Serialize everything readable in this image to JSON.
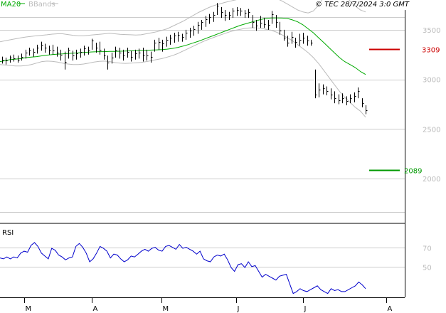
{
  "header": {
    "legend_ma": "MA20",
    "legend_bb": "BBands",
    "copyright": "© TEC 28/7/2024 3:0 GMT"
  },
  "colors": {
    "ma": "#00aa00",
    "bbands": "#bbbbbb",
    "price": "#000000",
    "rsi": "#0000cc",
    "resistance": "#cc0000",
    "support": "#009900",
    "grid": "#cccccc"
  },
  "chart_data": [
    {
      "type": "ohlc",
      "panel": "price",
      "y_ticks": [
        "3500",
        "3000",
        "2500",
        "2000"
      ],
      "ylim": [
        1550,
        3700
      ],
      "grid": true,
      "x_month_labels": [
        "M",
        "A",
        "M",
        "J",
        "J",
        "A"
      ],
      "resistance": {
        "value": 3309,
        "label": "3309"
      },
      "support": {
        "value": 2089,
        "label": "2089"
      },
      "bars": [
        {
          "h": 3230,
          "l": 3160,
          "c": 3200
        },
        {
          "h": 3220,
          "l": 3150,
          "c": 3190
        },
        {
          "h": 3240,
          "l": 3170,
          "c": 3220
        },
        {
          "h": 3250,
          "l": 3180,
          "c": 3210
        },
        {
          "h": 3240,
          "l": 3170,
          "c": 3200
        },
        {
          "h": 3260,
          "l": 3190,
          "c": 3230
        },
        {
          "h": 3300,
          "l": 3210,
          "c": 3270
        },
        {
          "h": 3320,
          "l": 3240,
          "c": 3290
        },
        {
          "h": 3310,
          "l": 3230,
          "c": 3280
        },
        {
          "h": 3350,
          "l": 3260,
          "c": 3320
        },
        {
          "h": 3380,
          "l": 3290,
          "c": 3350
        },
        {
          "h": 3360,
          "l": 3270,
          "c": 3320
        },
        {
          "h": 3340,
          "l": 3250,
          "c": 3300
        },
        {
          "h": 3350,
          "l": 3250,
          "c": 3290
        },
        {
          "h": 3330,
          "l": 3230,
          "c": 3270
        },
        {
          "h": 3300,
          "l": 3190,
          "c": 3250
        },
        {
          "h": 3280,
          "l": 3100,
          "c": 3180
        },
        {
          "h": 3320,
          "l": 3210,
          "c": 3290
        },
        {
          "h": 3290,
          "l": 3190,
          "c": 3240
        },
        {
          "h": 3300,
          "l": 3200,
          "c": 3260
        },
        {
          "h": 3310,
          "l": 3220,
          "c": 3280
        },
        {
          "h": 3340,
          "l": 3240,
          "c": 3310
        },
        {
          "h": 3330,
          "l": 3250,
          "c": 3300
        },
        {
          "h": 3410,
          "l": 3300,
          "c": 3390
        },
        {
          "h": 3370,
          "l": 3270,
          "c": 3320
        },
        {
          "h": 3380,
          "l": 3250,
          "c": 3300
        },
        {
          "h": 3310,
          "l": 3200,
          "c": 3240
        },
        {
          "h": 3240,
          "l": 3100,
          "c": 3170
        },
        {
          "h": 3270,
          "l": 3160,
          "c": 3220
        },
        {
          "h": 3330,
          "l": 3220,
          "c": 3300
        },
        {
          "h": 3320,
          "l": 3210,
          "c": 3270
        },
        {
          "h": 3300,
          "l": 3190,
          "c": 3240
        },
        {
          "h": 3320,
          "l": 3220,
          "c": 3280
        },
        {
          "h": 3290,
          "l": 3180,
          "c": 3230
        },
        {
          "h": 3300,
          "l": 3200,
          "c": 3260
        },
        {
          "h": 3310,
          "l": 3210,
          "c": 3270
        },
        {
          "h": 3320,
          "l": 3180,
          "c": 3250
        },
        {
          "h": 3300,
          "l": 3190,
          "c": 3240
        },
        {
          "h": 3280,
          "l": 3170,
          "c": 3230
        },
        {
          "h": 3400,
          "l": 3280,
          "c": 3370
        },
        {
          "h": 3420,
          "l": 3300,
          "c": 3380
        },
        {
          "h": 3400,
          "l": 3280,
          "c": 3360
        },
        {
          "h": 3430,
          "l": 3330,
          "c": 3400
        },
        {
          "h": 3450,
          "l": 3350,
          "c": 3420
        },
        {
          "h": 3470,
          "l": 3370,
          "c": 3440
        },
        {
          "h": 3480,
          "l": 3380,
          "c": 3450
        },
        {
          "h": 3460,
          "l": 3380,
          "c": 3430
        },
        {
          "h": 3500,
          "l": 3400,
          "c": 3470
        },
        {
          "h": 3520,
          "l": 3420,
          "c": 3490
        },
        {
          "h": 3540,
          "l": 3440,
          "c": 3510
        },
        {
          "h": 3580,
          "l": 3460,
          "c": 3550
        },
        {
          "h": 3600,
          "l": 3500,
          "c": 3580
        },
        {
          "h": 3640,
          "l": 3530,
          "c": 3610
        },
        {
          "h": 3660,
          "l": 3560,
          "c": 3630
        },
        {
          "h": 3680,
          "l": 3580,
          "c": 3650
        },
        {
          "h": 3770,
          "l": 3650,
          "c": 3740
        },
        {
          "h": 3730,
          "l": 3620,
          "c": 3680
        },
        {
          "h": 3700,
          "l": 3590,
          "c": 3650
        },
        {
          "h": 3680,
          "l": 3600,
          "c": 3650
        },
        {
          "h": 3720,
          "l": 3620,
          "c": 3690
        },
        {
          "h": 3730,
          "l": 3640,
          "c": 3700
        },
        {
          "h": 3720,
          "l": 3640,
          "c": 3690
        },
        {
          "h": 3700,
          "l": 3620,
          "c": 3670
        },
        {
          "h": 3710,
          "l": 3620,
          "c": 3680
        },
        {
          "h": 3650,
          "l": 3520,
          "c": 3580
        },
        {
          "h": 3600,
          "l": 3490,
          "c": 3540
        },
        {
          "h": 3640,
          "l": 3520,
          "c": 3570
        },
        {
          "h": 3620,
          "l": 3520,
          "c": 3560
        },
        {
          "h": 3600,
          "l": 3500,
          "c": 3550
        },
        {
          "h": 3690,
          "l": 3560,
          "c": 3660
        },
        {
          "h": 3650,
          "l": 3520,
          "c": 3580
        },
        {
          "h": 3580,
          "l": 3450,
          "c": 3490
        },
        {
          "h": 3500,
          "l": 3390,
          "c": 3420
        },
        {
          "h": 3440,
          "l": 3330,
          "c": 3370
        },
        {
          "h": 3480,
          "l": 3360,
          "c": 3430
        },
        {
          "h": 3420,
          "l": 3320,
          "c": 3380
        },
        {
          "h": 3460,
          "l": 3340,
          "c": 3400
        },
        {
          "h": 3470,
          "l": 3360,
          "c": 3420
        },
        {
          "h": 3440,
          "l": 3340,
          "c": 3390
        },
        {
          "h": 3400,
          "l": 3340,
          "c": 3370
        },
        {
          "h": 3100,
          "l": 2810,
          "c": 2850
        },
        {
          "h": 2960,
          "l": 2820,
          "c": 2900
        },
        {
          "h": 2950,
          "l": 2850,
          "c": 2910
        },
        {
          "h": 2930,
          "l": 2840,
          "c": 2880
        },
        {
          "h": 2910,
          "l": 2800,
          "c": 2850
        },
        {
          "h": 2880,
          "l": 2760,
          "c": 2810
        },
        {
          "h": 2850,
          "l": 2750,
          "c": 2790
        },
        {
          "h": 2860,
          "l": 2760,
          "c": 2810
        },
        {
          "h": 2830,
          "l": 2740,
          "c": 2780
        },
        {
          "h": 2850,
          "l": 2760,
          "c": 2810
        },
        {
          "h": 2870,
          "l": 2770,
          "c": 2830
        },
        {
          "h": 2920,
          "l": 2810,
          "c": 2880
        },
        {
          "h": 2810,
          "l": 2720,
          "c": 2760
        },
        {
          "h": 2740,
          "l": 2650,
          "c": 2690
        }
      ],
      "ma20": [
        3180,
        3190,
        3200,
        3205,
        3210,
        3220,
        3225,
        3230,
        3238,
        3245,
        3250,
        3255,
        3258,
        3262,
        3265,
        3268,
        3272,
        3275,
        3278,
        3280,
        3280,
        3282,
        3283,
        3284,
        3286,
        3288,
        3290,
        3292,
        3294,
        3296,
        3298,
        3300,
        3305,
        3312,
        3322,
        3335,
        3350,
        3368,
        3385,
        3405,
        3425,
        3445,
        3465,
        3485,
        3505,
        3525,
        3545,
        3560,
        3575,
        3590,
        3605,
        3615,
        3620,
        3620,
        3618,
        3615,
        3600,
        3580,
        3550,
        3510,
        3470,
        3420,
        3370,
        3320,
        3270,
        3220,
        3180,
        3150,
        3120,
        3080,
        3050
      ],
      "bb_upper": [
        3380,
        3390,
        3400,
        3410,
        3420,
        3428,
        3434,
        3440,
        3445,
        3450,
        3456,
        3460,
        3460,
        3452,
        3445,
        3440,
        3440,
        3445,
        3450,
        3455,
        3460,
        3465,
        3460,
        3455,
        3452,
        3450,
        3448,
        3450,
        3460,
        3470,
        3480,
        3495,
        3510,
        3535,
        3560,
        3585,
        3615,
        3645,
        3675,
        3700,
        3725,
        3745,
        3760,
        3775,
        3788,
        3800,
        3812,
        3822,
        3830,
        3835,
        3835,
        3835,
        3828,
        3815,
        3790,
        3760,
        3730,
        3700,
        3680,
        3670,
        3690,
        3750,
        3830,
        3910,
        3930,
        3900,
        3850,
        3790,
        3740,
        3700,
        3680
      ],
      "bb_lower": [
        3150,
        3145,
        3140,
        3135,
        3135,
        3140,
        3150,
        3165,
        3180,
        3185,
        3182,
        3175,
        3165,
        3155,
        3150,
        3150,
        3155,
        3165,
        3175,
        3182,
        3185,
        3180,
        3170,
        3165,
        3162,
        3165,
        3168,
        3172,
        3180,
        3190,
        3200,
        3210,
        3225,
        3240,
        3260,
        3285,
        3310,
        3335,
        3360,
        3385,
        3405,
        3425,
        3445,
        3462,
        3480,
        3495,
        3505,
        3515,
        3520,
        3520,
        3515,
        3505,
        3495,
        3475,
        3450,
        3420,
        3390,
        3350,
        3310,
        3270,
        3220,
        3160,
        3090,
        3020,
        2950,
        2880,
        2820,
        2770,
        2720,
        2680,
        2620
      ],
      "overlay_x_range": [
        0,
        514
      ]
    },
    {
      "type": "line",
      "panel": "rsi",
      "title": "RSI",
      "y_ticks": [
        "70",
        "50"
      ],
      "ylim": [
        18,
        92
      ],
      "values": [
        59,
        58,
        60,
        58,
        60,
        59,
        64,
        66,
        65,
        72,
        75,
        71,
        64,
        61,
        58,
        69,
        67,
        62,
        60,
        57,
        59,
        60,
        71,
        74,
        70,
        64,
        55,
        58,
        64,
        71,
        69,
        66,
        59,
        63,
        62,
        58,
        55,
        57,
        61,
        60,
        63,
        66,
        68,
        66,
        69,
        70,
        67,
        66,
        71,
        72,
        70,
        68,
        73,
        69,
        70,
        68,
        66,
        63,
        66,
        58,
        56,
        55,
        60,
        62,
        61,
        63,
        57,
        49,
        45,
        52,
        53,
        49,
        55,
        50,
        51,
        45,
        39,
        42,
        40,
        38,
        36,
        40,
        41,
        42,
        32,
        22,
        24,
        27,
        25,
        24,
        26,
        28,
        30,
        26,
        24,
        22,
        27,
        25,
        26,
        24,
        24,
        26,
        28,
        30,
        34,
        31,
        27
      ]
    }
  ]
}
